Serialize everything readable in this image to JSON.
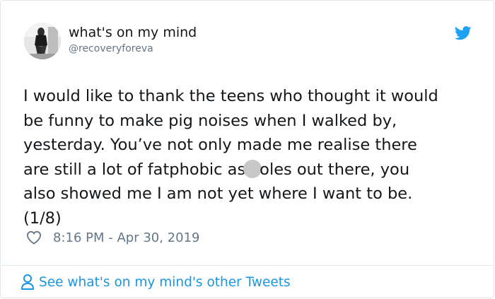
{
  "tweet": {
    "display_name": "what's on my mind",
    "handle": "@recoveryforeva",
    "text_lines": [
      "I would like to thank the teens who thought it would",
      "be funny to make pig noises when I walked by,",
      "yesterday. You’ve not only made me realise there",
      [
        "are still a lot of fatphobic as",
        "oles out there, you"
      ],
      "also showed me I am not yet where I want to be.",
      "(1/8)"
    ],
    "timestamp": "8:16 PM - Apr 30, 2019"
  },
  "footer": {
    "more_tweets_label": "See what's on my mind's other Tweets"
  },
  "icons": {
    "brand": "twitter-bird-icon",
    "like": "heart-icon",
    "profile": "user-icon"
  },
  "colors": {
    "twitter_blue": "#1da1f2",
    "link_blue": "#1b95e0",
    "secondary_text": "#657786",
    "censor_dot": "#c8c8c8"
  }
}
